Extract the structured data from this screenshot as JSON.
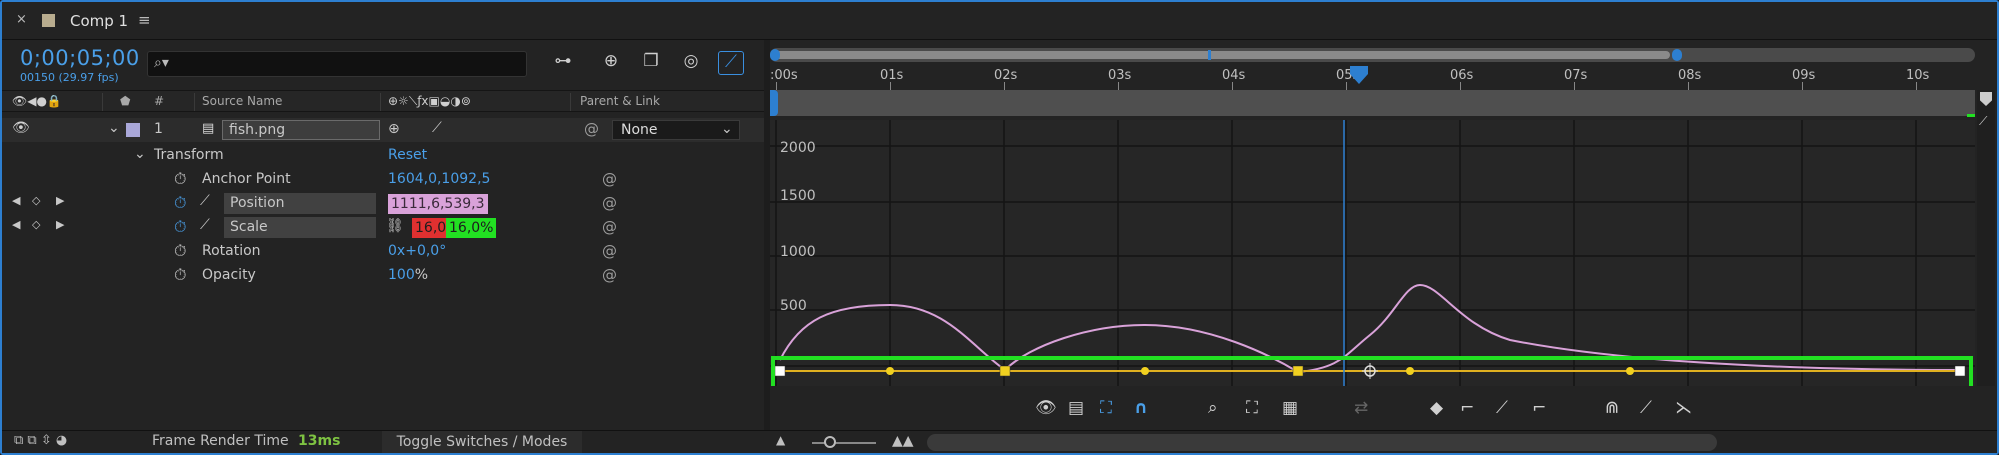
{
  "tab": {
    "close": "×",
    "title": "Comp 1",
    "menu": "≡"
  },
  "timecode": {
    "value": "0;00;05;00",
    "fps": "00150 (29.97 fps)"
  },
  "search": {
    "placeholder": ""
  },
  "columns": {
    "number": "#",
    "source_name": "Source Name",
    "parent_link": "Parent & Link"
  },
  "layer": {
    "index": "1",
    "name": "fish.png",
    "label_color": "#a9a7d8",
    "parent": "None"
  },
  "transform": {
    "label": "Transform",
    "reset": "Reset",
    "properties": [
      {
        "name": "Anchor Point",
        "value": "1604,0,1092,5"
      },
      {
        "name": "Position",
        "value": "1111,6,539,3"
      },
      {
        "name": "Scale",
        "value_x": "16,0",
        "value_y": "16,0%"
      },
      {
        "name": "Rotation",
        "value_prefix": "0",
        "value_suffix": "x+0,0°"
      },
      {
        "name": "Opacity",
        "value_num": "100",
        "value_unit": "%"
      }
    ]
  },
  "time_ruler": {
    "labels": [
      ":00s",
      "01s",
      "02s",
      "03s",
      "04s",
      "05s",
      "06s",
      "07s",
      "08s",
      "09s",
      "10s"
    ],
    "current_time_s": 5
  },
  "graph": {
    "y_labels": [
      "2000",
      "1500",
      "1000",
      "500"
    ],
    "highlight_color": "#22e022",
    "curve_color": "#d9a2d9",
    "value_line_color": "#e0b020"
  },
  "status": {
    "frame_render_label": "Frame Render Time",
    "frame_render_value": "13ms",
    "toggle_label": "Toggle Switches / Modes"
  }
}
